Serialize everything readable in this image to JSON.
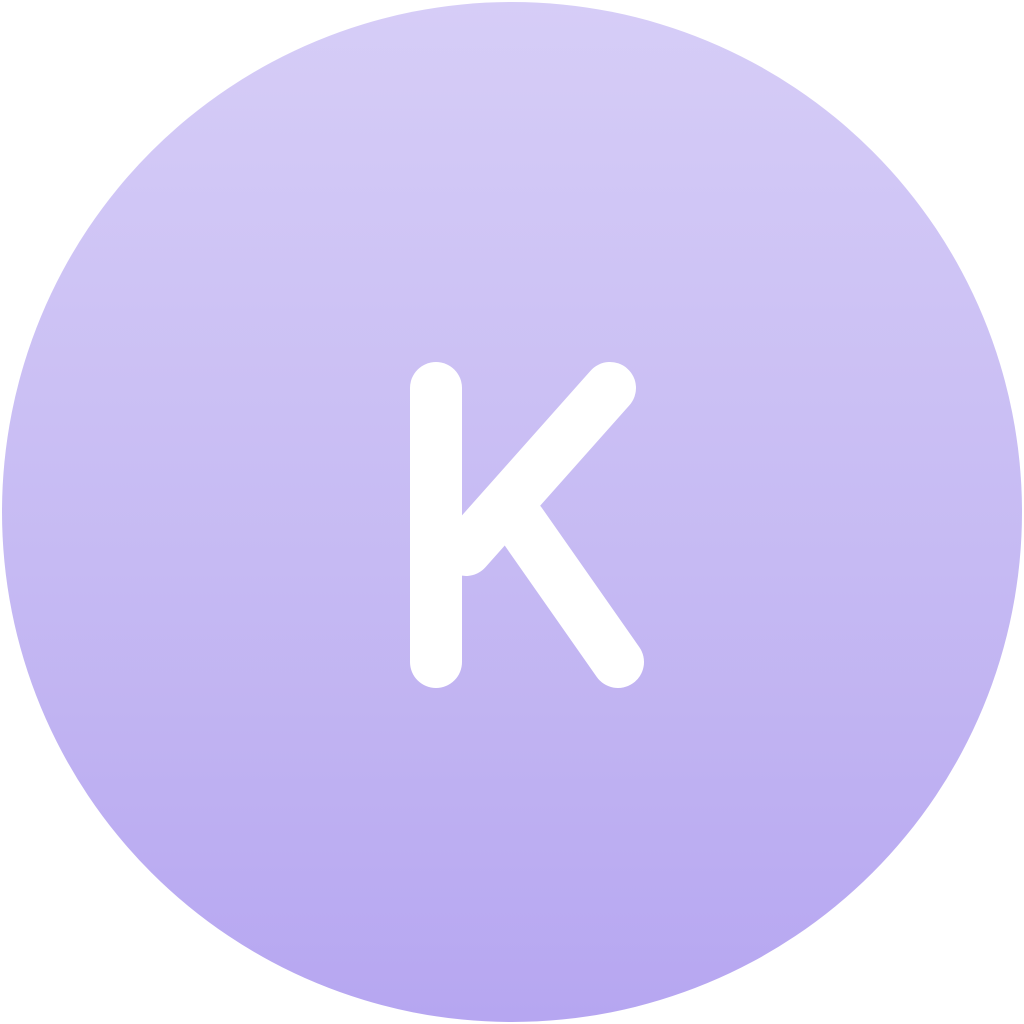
{
  "avatar": {
    "initial": "K",
    "background_top_color": "#d6cdf7",
    "background_bottom_color": "#b6a6f1",
    "initial_color": "#ffffff"
  }
}
